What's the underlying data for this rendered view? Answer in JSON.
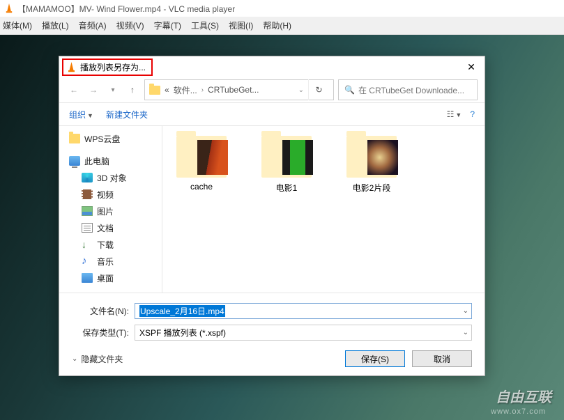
{
  "vlc": {
    "title": "【MAMAMOO】MV- Wind Flower.mp4 - VLC media player",
    "menus": [
      "媒体(M)",
      "播放(L)",
      "音频(A)",
      "视频(V)",
      "字幕(T)",
      "工具(S)",
      "视图(I)",
      "帮助(H)"
    ]
  },
  "watermark": {
    "main": "自由互联",
    "sub": "www.ox7.com"
  },
  "dialog": {
    "title": "播放列表另存为...",
    "close": "✕",
    "nav": {
      "back": "←",
      "fwd": "→",
      "up": "↑",
      "path_prefix": "«",
      "path_seg1": "软件...",
      "path_seg2": "CRTubeGet...",
      "search_placeholder": "在 CRTubeGet Downloade..."
    },
    "toolbar": {
      "organize": "组织",
      "newfolder": "新建文件夹"
    },
    "sidebar": [
      {
        "icon": "folder",
        "label": "WPS云盘",
        "child": false
      },
      {
        "icon": "pc",
        "label": "此电脑",
        "child": false
      },
      {
        "icon": "3d",
        "label": "3D 对象",
        "child": true
      },
      {
        "icon": "video",
        "label": "视频",
        "child": true
      },
      {
        "icon": "pic",
        "label": "图片",
        "child": true
      },
      {
        "icon": "doc",
        "label": "文档",
        "child": true
      },
      {
        "icon": "dl",
        "label": "下载",
        "child": true
      },
      {
        "icon": "music",
        "label": "音乐",
        "child": true
      },
      {
        "icon": "desk",
        "label": "桌面",
        "child": true
      }
    ],
    "folders": [
      {
        "name": "cache",
        "cls": "c1"
      },
      {
        "name": "电影1",
        "cls": "c2"
      },
      {
        "name": "电影2片段",
        "cls": "c3"
      }
    ],
    "filename_label": "文件名(N):",
    "filename_value": "Upscale_2月16日.mp4",
    "filetype_label": "保存类型(T):",
    "filetype_value": "XSPF 播放列表 (*.xspf)",
    "hide_folders": "隐藏文件夹",
    "save": "保存(S)",
    "cancel": "取消"
  }
}
